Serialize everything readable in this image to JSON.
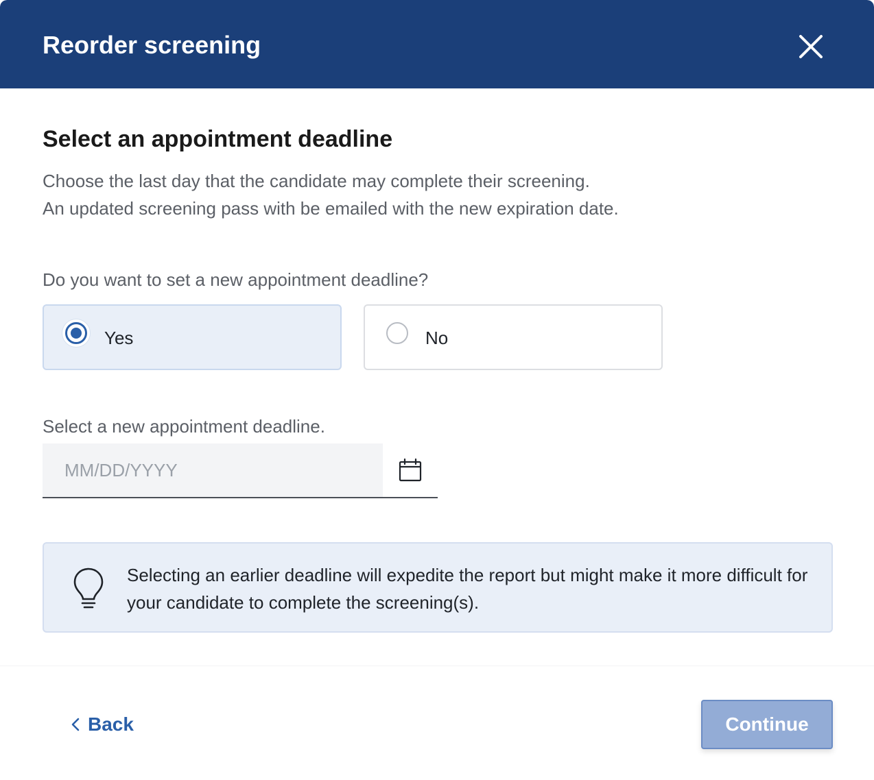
{
  "dialog": {
    "title": "Reorder screening",
    "close_icon": "close-icon"
  },
  "content": {
    "heading": "Select an appointment deadline",
    "description_lines": [
      "Choose the last day that the candidate may complete their screening.",
      "An updated screening pass with be emailed with the new expiration date."
    ],
    "question": "Do you want to set a new appointment deadline?",
    "options": [
      {
        "label": "Yes",
        "selected": true
      },
      {
        "label": "No",
        "selected": false
      }
    ],
    "date": {
      "label": "Select a new appointment deadline.",
      "placeholder": "MM/DD/YYYY",
      "value": "",
      "icon": "calendar-icon"
    },
    "info": {
      "icon": "lightbulb-icon",
      "text": "Selecting an earlier deadline will expedite the report but might make it more difficult for your candidate to complete the screening(s)."
    }
  },
  "footer": {
    "back_label": "Back",
    "back_icon": "chevron-left-icon",
    "continue_label": "Continue"
  },
  "colors": {
    "header_bg": "#1b3f79",
    "accent": "#2a5fa8",
    "selected_bg": "#e9eff8",
    "continue_disabled_bg": "#93acd6"
  }
}
